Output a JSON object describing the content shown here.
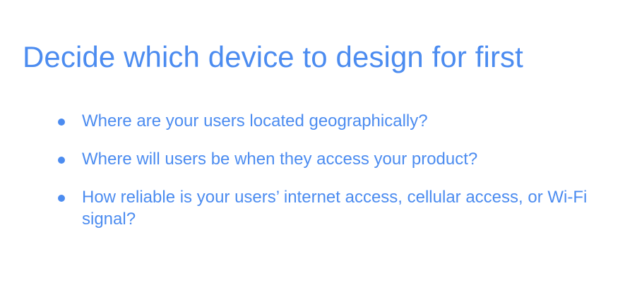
{
  "slide": {
    "title": "Decide which device to design for first",
    "bullets": [
      "Where are your users located geographically?",
      "Where will users be when they access your product?",
      "How reliable is your users’ internet access, cellular access, or Wi-Fi signal?"
    ],
    "accent_color": "#4c8cf0",
    "background_color": "#ffffff"
  }
}
